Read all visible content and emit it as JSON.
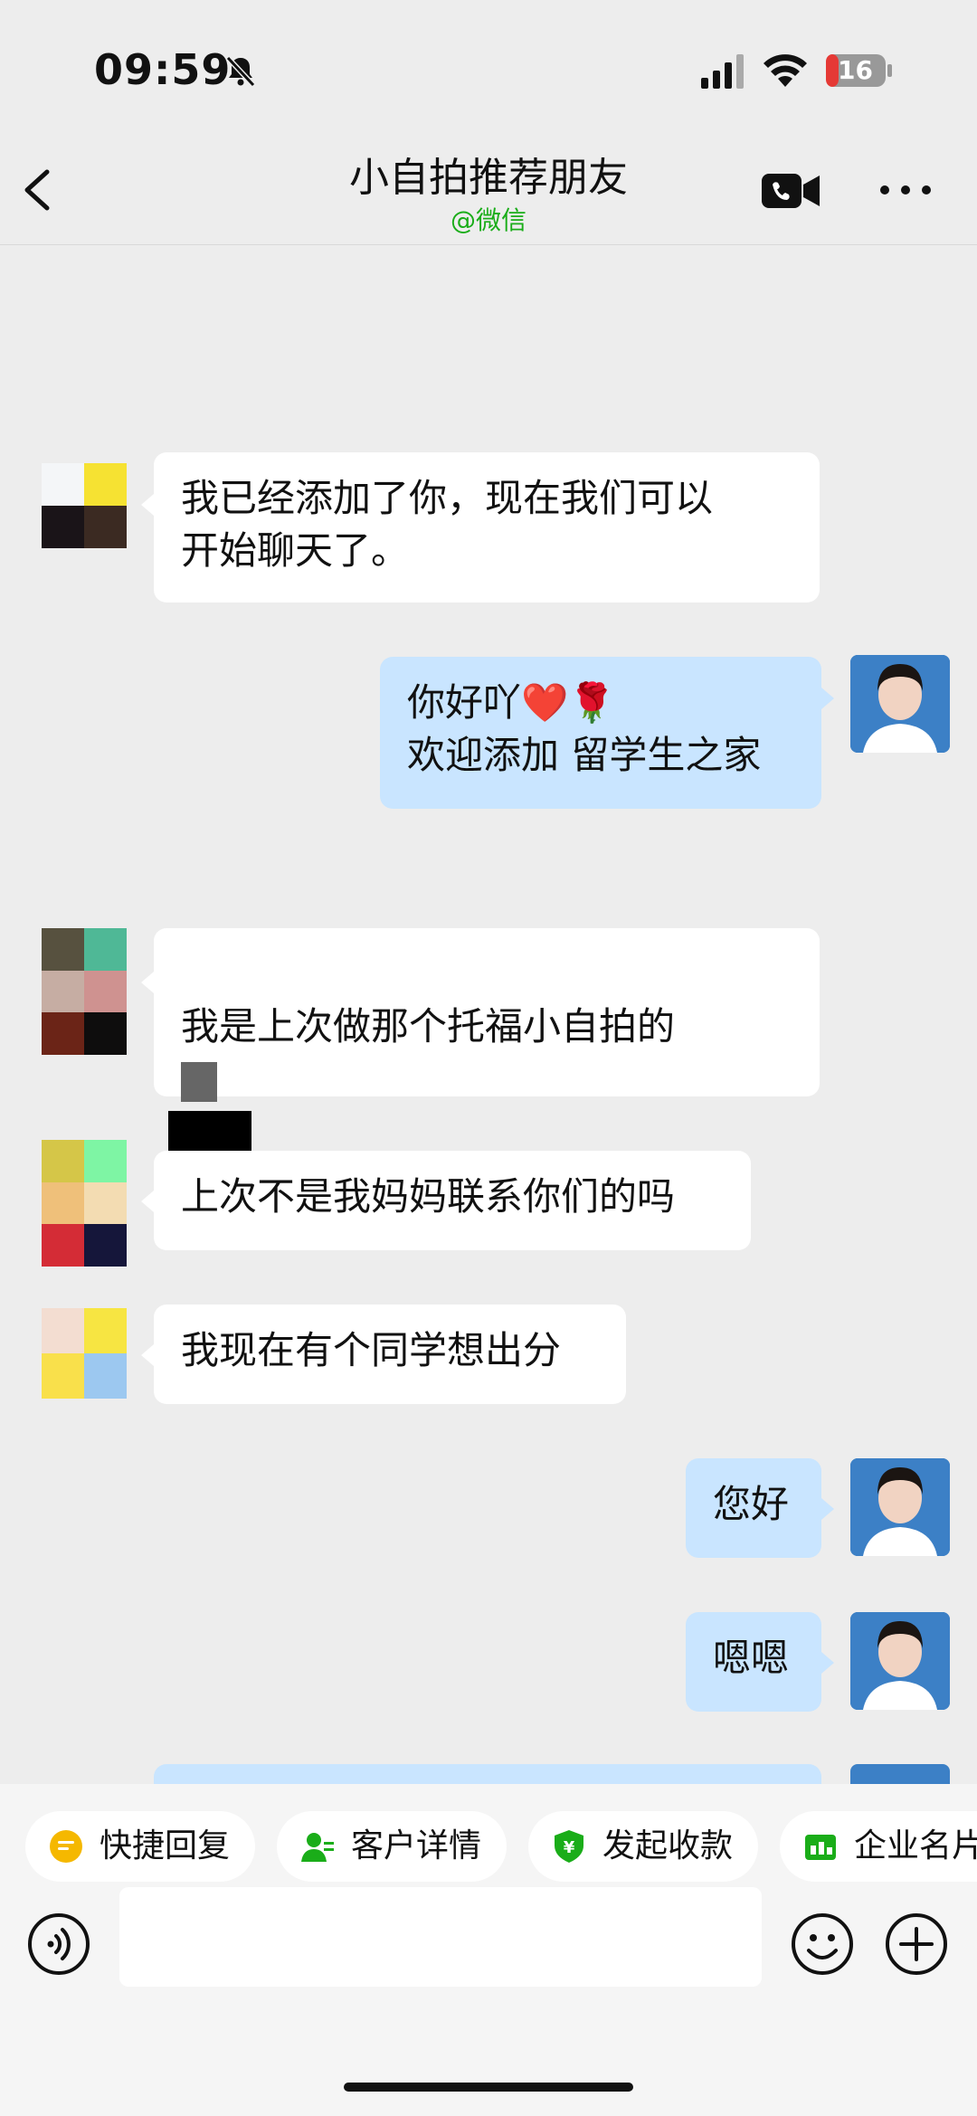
{
  "status_bar": {
    "time": "09:59",
    "battery": "16"
  },
  "header": {
    "title": "小自拍推荐朋友",
    "subtitle": "@微信"
  },
  "messages": [
    {
      "side": "left",
      "text": "我已经添加了你，现在我们可以\n开始聊天了。"
    },
    {
      "side": "right",
      "text": "你好吖❤️🌹\n欢迎添加 留学生之家"
    },
    {
      "side": "left",
      "text": "我是上次做那个托福小自拍的"
    },
    {
      "side": "left",
      "text": "上次不是我妈妈联系你们的吗"
    },
    {
      "side": "left",
      "text": "我现在有个同学想出分"
    },
    {
      "side": "right",
      "text": "您好"
    },
    {
      "side": "right",
      "text": "嗯嗯"
    }
  ],
  "quick_actions": [
    {
      "label": "快捷回复",
      "icon": "quick-reply-icon",
      "color": "#f5b800"
    },
    {
      "label": "客户详情",
      "icon": "customer-detail-icon",
      "color": "#1aad19"
    },
    {
      "label": "发起收款",
      "icon": "payment-icon",
      "color": "#1aad19"
    },
    {
      "label": "企业名片",
      "icon": "business-card-icon",
      "color": "#1aad19"
    }
  ],
  "colors": {
    "accent": "#1aad19",
    "bubble_self": "#c9e5ff",
    "bubble_other": "#ffffff",
    "background": "#ededed"
  }
}
